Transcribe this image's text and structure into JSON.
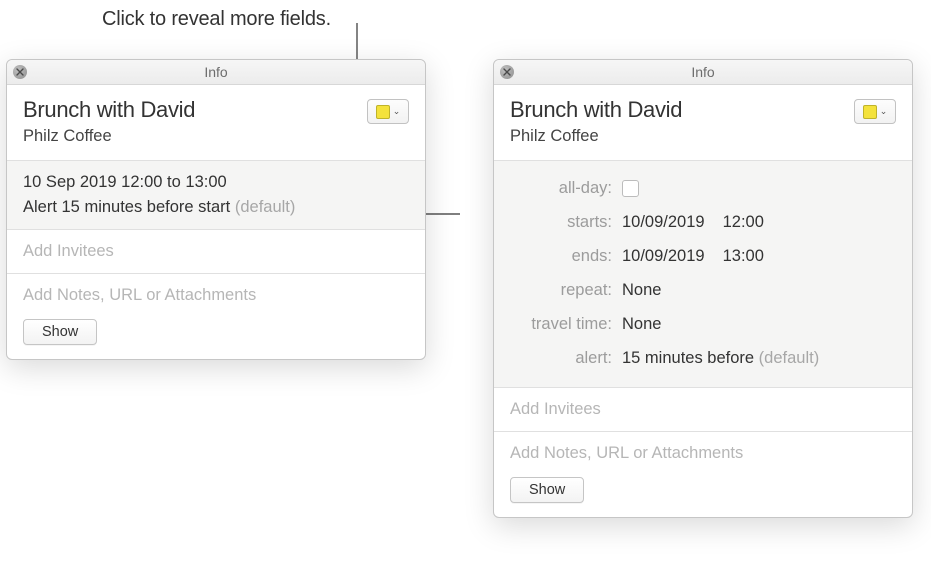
{
  "caption": "Click to reveal more fields.",
  "windowTitle": "Info",
  "event": {
    "title": "Brunch with David",
    "location": "Philz Coffee"
  },
  "calendarSwatchColor": "#f4e23b",
  "summary": {
    "dateLine": "10 Sep 2019  12:00 to 13:00",
    "alertText": "Alert 15 minutes before start",
    "alertSuffix": " (default)"
  },
  "labels": {
    "addInvitees": "Add Invitees",
    "addNotes": "Add Notes, URL or Attachments",
    "showButton": "Show",
    "allDay": "all-day:",
    "starts": "starts:",
    "ends": "ends:",
    "repeat": "repeat:",
    "travelTime": "travel time:",
    "alert": "alert:"
  },
  "values": {
    "startDate": "10/09/2019",
    "startTime": "12:00",
    "endDate": "10/09/2019",
    "endTime": "13:00",
    "repeat": "None",
    "travelTime": "None",
    "alert": "15 minutes before",
    "alertSuffix": " (default)"
  }
}
